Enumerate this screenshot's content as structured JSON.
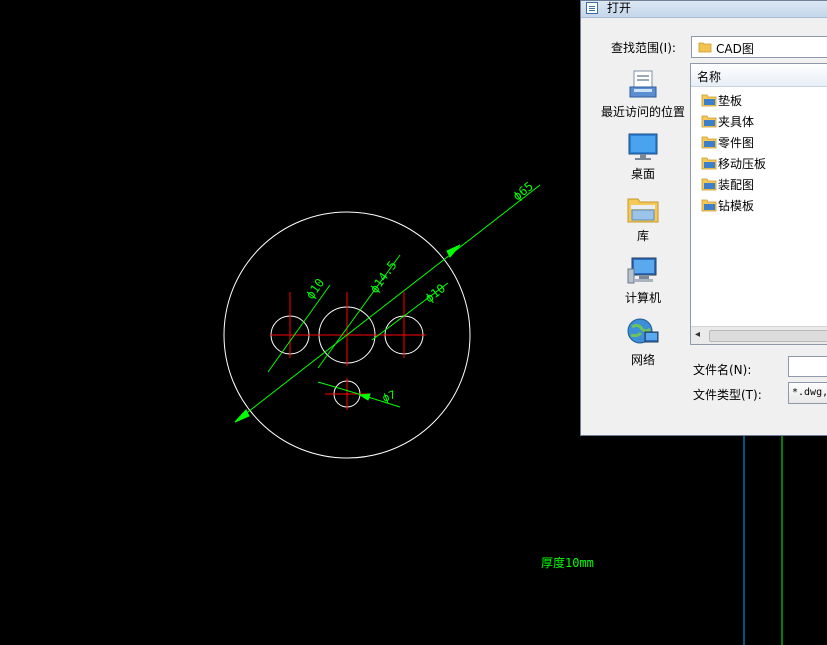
{
  "drawing": {
    "dim_outer": "ϕ65",
    "dim_center_hole": "ϕ14.5",
    "dim_left_hole": "ϕ10",
    "dim_right_hole": "ϕ10",
    "dim_bottom_hole": "ϕ7",
    "thickness_note": "厚度10mm",
    "colors": {
      "outline": "#ffffff",
      "centerline": "#ff0000",
      "dimension": "#00ff00",
      "side_line": "#00aaff"
    }
  },
  "dialog": {
    "title": "打开",
    "look_in_label": "查找范围(I):",
    "look_in_value": "CAD图",
    "places": [
      {
        "label": "最近访问的位置",
        "icon": "recent-places-icon"
      },
      {
        "label": "桌面",
        "icon": "desktop-icon"
      },
      {
        "label": "库",
        "icon": "libraries-icon"
      },
      {
        "label": "计算机",
        "icon": "computer-icon"
      },
      {
        "label": "网络",
        "icon": "network-icon"
      }
    ],
    "column_name": "名称",
    "items": [
      "垫板",
      "夹具体",
      "零件图",
      "移动压板",
      "装配图",
      "钻模板"
    ],
    "file_name_label": "文件名(N):",
    "file_name_value": "",
    "file_type_label": "文件类型(T):",
    "file_type_value": "*.dwg,"
  }
}
